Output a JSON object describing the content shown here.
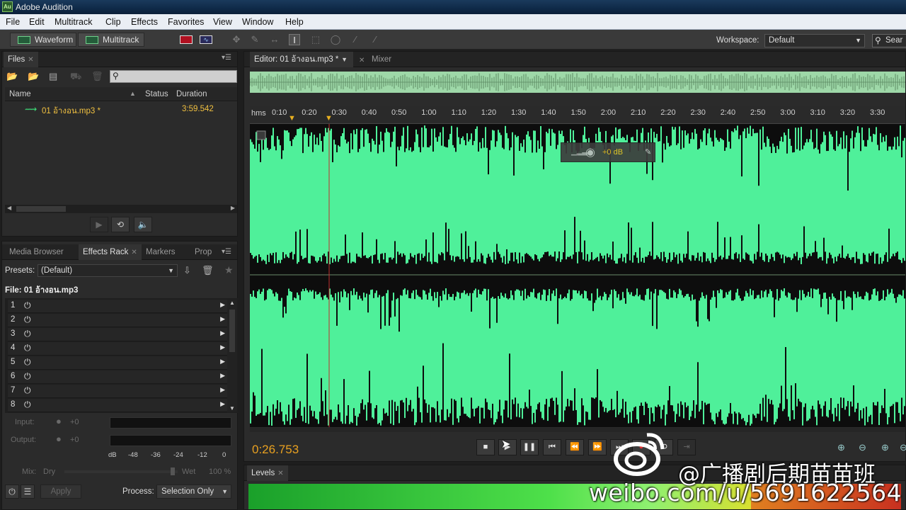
{
  "app": {
    "title": "Adobe Audition",
    "icon_label": "Au"
  },
  "menu": [
    "File",
    "Edit",
    "Multitrack",
    "Clip",
    "Effects",
    "Favorites",
    "View",
    "Window",
    "Help"
  ],
  "toolbar": {
    "waveform_label": "Waveform",
    "multitrack_label": "Multitrack",
    "workspace_label": "Workspace:",
    "workspace_value": "Default",
    "search_text": "Sear"
  },
  "files_panel": {
    "tab": "Files",
    "columns": [
      "Name",
      "Status",
      "Duration"
    ],
    "rows": [
      {
        "name": "01 อ้างอน.mp3 *",
        "duration": "3:59.542"
      }
    ]
  },
  "editor": {
    "tab": "Editor: 01 อ้างอน.mp3 *",
    "mixer_tab": "Mixer",
    "ruler_unit": "hms",
    "ruler_ticks": [
      "0:10",
      "0:20",
      "0:30",
      "0:40",
      "0:50",
      "1:00",
      "1:10",
      "1:20",
      "1:30",
      "1:40",
      "1:50",
      "2:00",
      "2:10",
      "2:20",
      "2:30",
      "2:40",
      "2:50",
      "3:00",
      "3:10",
      "3:20",
      "3:30"
    ],
    "hud_gain": "+0 dB",
    "current_time": "0:26.753",
    "waveform_color": "#4ff09a"
  },
  "effects_panel": {
    "tabs": [
      "Media Browser",
      "Effects Rack",
      "Markers",
      "Prop"
    ],
    "presets_label": "Presets:",
    "presets_value": "(Default)",
    "file_label": "File: 01 อ้างอน.mp3",
    "slots": [
      "1",
      "2",
      "3",
      "4",
      "5",
      "6",
      "7",
      "8"
    ],
    "input_label": "Input:",
    "input_value": "+0",
    "output_label": "Output:",
    "output_value": "+0",
    "meter_scale": [
      "dB",
      "-48",
      "-36",
      "-24",
      "-12",
      "0"
    ],
    "mix_label": "Mix:",
    "dry_label": "Dry",
    "wet_label": "Wet",
    "wet_value": "100 %",
    "apply_label": "Apply",
    "process_label": "Process:",
    "process_value": "Selection Only"
  },
  "levels_panel": {
    "tab": "Levels"
  },
  "watermark": {
    "handle": "@广播剧后期苗苗班",
    "url": "weibo.com/u/5691622564"
  }
}
